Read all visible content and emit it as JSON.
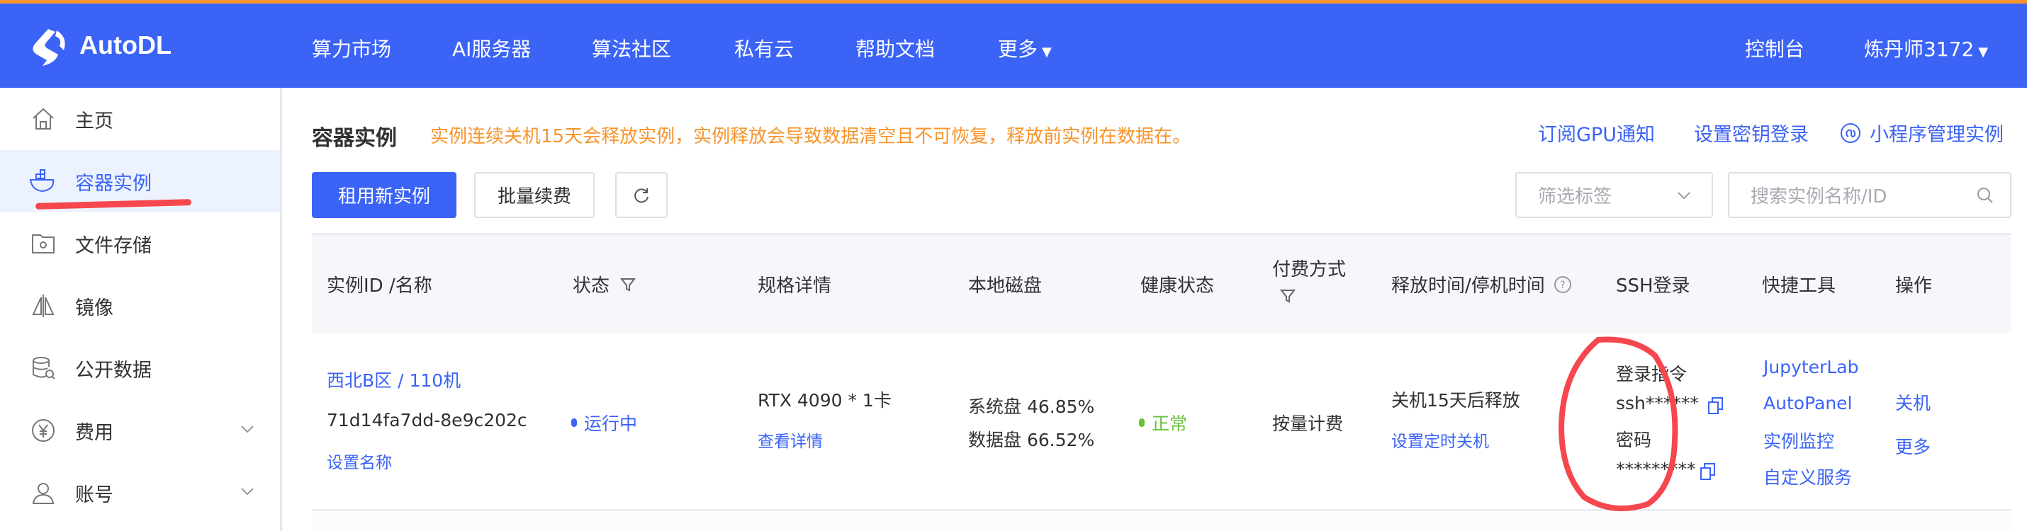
{
  "header": {
    "logo": "AutoDL",
    "nav": [
      "算力市场",
      "AI服务器",
      "算法社区",
      "私有云",
      "帮助文档",
      "更多"
    ],
    "console": "控制台",
    "user": "炼丹师3172"
  },
  "sidebar": {
    "items": [
      {
        "label": "主页",
        "icon": "home-icon"
      },
      {
        "label": "容器实例",
        "icon": "docker-icon"
      },
      {
        "label": "文件存储",
        "icon": "folder-gear-icon"
      },
      {
        "label": "镜像",
        "icon": "image-mirror-icon"
      },
      {
        "label": "公开数据",
        "icon": "database-search-icon"
      },
      {
        "label": "费用",
        "icon": "yen-icon"
      },
      {
        "label": "账号",
        "icon": "user-icon"
      }
    ]
  },
  "main": {
    "title": "容器实例",
    "warning": "实例连续关机15天会释放实例，实例释放会导致数据清空且不可恢复，释放前实例在数据在。",
    "links": {
      "gpu_notify": "订阅GPU通知",
      "ssh_key": "设置密钥登录",
      "miniprogram": "小程序管理实例"
    },
    "buttons": {
      "rent": "租用新实例",
      "renew": "批量续费"
    },
    "filter_placeholder": "筛选标签",
    "search_placeholder": "搜索实例名称/ID",
    "columns": [
      "实例ID /名称",
      "状态",
      "规格详情",
      "本地磁盘",
      "健康状态",
      "付费方式",
      "释放时间/停机时间",
      "SSH登录",
      "快捷工具",
      "操作"
    ],
    "row": {
      "name": "西北B区 / 110机",
      "id": "71d14fa7dd-8e9c202c",
      "set_name": "设置名称",
      "status": "运行中",
      "spec": "RTX 4090 * 1卡",
      "spec_detail": "查看详情",
      "sys_disk": "系统盘 46.85%",
      "data_disk": "数据盘 66.52%",
      "health": "正常",
      "billing": "按量计费",
      "release": "关机15天后释放",
      "set_shutdown": "设置定时关机",
      "ssh_label": "登录指令",
      "ssh_cmd": "ssh******",
      "pwd_label": "密码",
      "pwd": "*********",
      "tools": [
        "JupyterLab",
        "AutoPanel",
        "实例监控",
        "自定义服务"
      ],
      "ops": [
        "关机",
        "更多"
      ]
    }
  },
  "colors": {
    "brand": "#3b63f6",
    "warning": "#f7952c",
    "success": "#67c23a",
    "annotation": "#f5474d"
  }
}
